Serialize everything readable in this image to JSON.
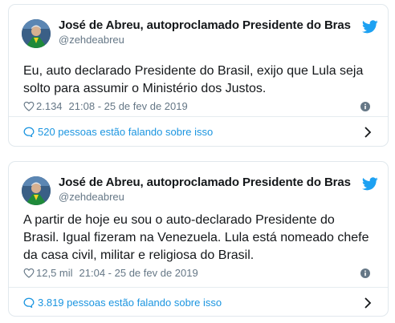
{
  "colors": {
    "text": "#14171a",
    "muted": "#657786",
    "link": "#1b95e0",
    "border": "#e1e8ed"
  },
  "tweets": [
    {
      "author_name": "José de Abreu, autoproclamado Presidente do Bras",
      "handle": "@zehdeabreu",
      "text": "Eu, auto declarado Presidente do Brasil, exijo que Lula seja solto para assumir o Ministério dos Justos.",
      "likes": "2.134",
      "timestamp": "21:08 - 25 de fev de 2019",
      "talking": "520 pessoas estão falando sobre isso",
      "icons": [
        "avatar",
        "twitter-bird-icon",
        "heart-icon",
        "info-icon",
        "speech-bubble-icon",
        "chevron-right-icon"
      ]
    },
    {
      "author_name": "José de Abreu, autoproclamado Presidente do Bras",
      "handle": "@zehdeabreu",
      "text": "A partir de hoje eu sou o auto-declarado Presidente do Brasil. Igual fizeram na Venezuela. Lula está nomeado chefe da casa civil, militar e religiosa do Brasil.",
      "likes": "12,5 mil",
      "timestamp": "21:04 - 25 de fev de 2019",
      "talking": "3.819 pessoas estão falando sobre isso",
      "icons": [
        "avatar",
        "twitter-bird-icon",
        "heart-icon",
        "info-icon",
        "speech-bubble-icon",
        "chevron-right-icon"
      ]
    }
  ]
}
